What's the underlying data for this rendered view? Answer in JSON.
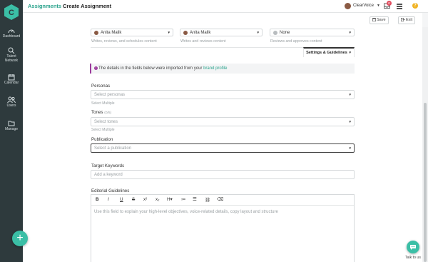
{
  "sidebar": {
    "items": [
      {
        "label": "Dashboard",
        "icon": "dashboard-icon"
      },
      {
        "label": "Talent Network",
        "icon": "search-icon"
      },
      {
        "label": "Calendar",
        "icon": "calendar-icon"
      },
      {
        "label": "Users",
        "icon": "users-icon"
      },
      {
        "label": "Manage",
        "icon": "folder-icon"
      }
    ],
    "fab_label": "+"
  },
  "header": {
    "breadcrumb": "Assignments",
    "title": "Create Assignment",
    "user_name": "ClearVoice",
    "notification_count": "0",
    "help_label": "?"
  },
  "actions": {
    "save": "Save",
    "exit": "Exit"
  },
  "roles": [
    {
      "selected": "Anita Malik",
      "hint": "Writes, reviews, and schedules content"
    },
    {
      "selected": "Anita Malik",
      "hint": "Writes and reviews content"
    },
    {
      "selected": "None",
      "hint": "Reviews and approves content"
    }
  ],
  "settings_tab": "Settings & Guidelines",
  "info": {
    "text": "The details in the fields below were imported from your ",
    "link": "brand profile"
  },
  "form": {
    "personas": {
      "label": "Personas",
      "placeholder": "Select personas",
      "hint": "Select Multiple"
    },
    "tones": {
      "label": "Tones",
      "optional": "(0/5)",
      "placeholder": "Select tones",
      "hint": "Select Multiple"
    },
    "publication": {
      "label": "Publication",
      "placeholder": "Select a publication"
    },
    "keywords": {
      "label": "Target Keywords",
      "placeholder": "Add a keyword"
    },
    "guidelines": {
      "label": "Editorial Guidelines",
      "placeholder": "Use this field to explain your high-level objectives, voice-related details, copy layout and structure",
      "toolbar": [
        "B",
        "I",
        "U",
        "S",
        "x²",
        "x₂",
        "H▾",
        "≔",
        "☰",
        "⛓",
        "⌫"
      ]
    }
  },
  "chat": {
    "label": "Talk to us"
  },
  "colors": {
    "brand": "#2aa38c",
    "accent": "#3bbfa6",
    "sidebar": "#2e3a3d",
    "info_border": "#9b3a9b",
    "badge": "#e04d5f",
    "help": "#f0b323"
  }
}
